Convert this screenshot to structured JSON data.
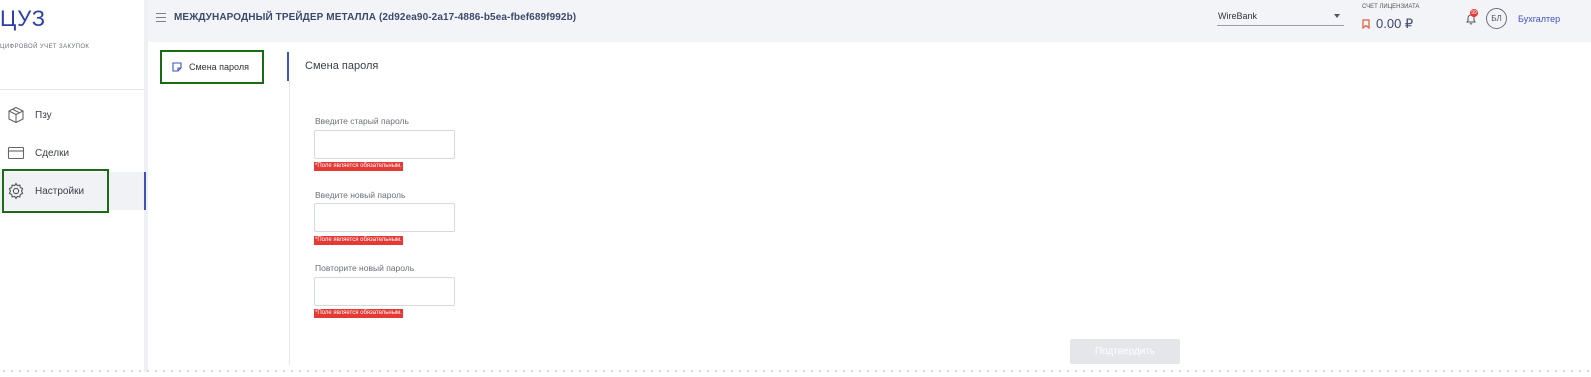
{
  "app": {
    "logo": "ЦУЗ",
    "logo_subtitle": "ЦИФРОВОЙ УЧЕТ ЗАКУПОК"
  },
  "sidebar": {
    "items": [
      {
        "label": "Пзу",
        "icon": "box-icon"
      },
      {
        "label": "Сделки",
        "icon": "card-icon"
      },
      {
        "label": "Настройки",
        "icon": "gear-icon",
        "active": true
      }
    ]
  },
  "header": {
    "org_title": "МЕЖДУНАРОДНЫЙ ТРЕЙДЕР МЕТАЛЛА (2d92ea90-2a17-4886-b5ea-fbef689f992b)",
    "bank_select": "WireBank",
    "account_label": "СЧЕТ ЛИЦЕНЗИАТА",
    "account_value": "0.00 ₽",
    "notifications_count": "99",
    "avatar_initials": "БЛ",
    "role": "Бухгалтер"
  },
  "submenu": {
    "items": [
      {
        "label": "Смена пароля",
        "icon": "note-icon"
      }
    ]
  },
  "form": {
    "title": "Смена пароля",
    "fields": [
      {
        "label": "Введите старый пароль",
        "value": "",
        "error": "*Поле является обязательным."
      },
      {
        "label": "Введите новый пароль",
        "value": "",
        "error": "*Поле является обязательным."
      },
      {
        "label": "Повторите новый пароль",
        "value": "",
        "error": "*Поле является обязательным."
      }
    ],
    "submit_label": "Подтвердить"
  },
  "colors": {
    "accent": "#3e52c0",
    "error": "#e53935",
    "highlight": "#1b6b14"
  }
}
